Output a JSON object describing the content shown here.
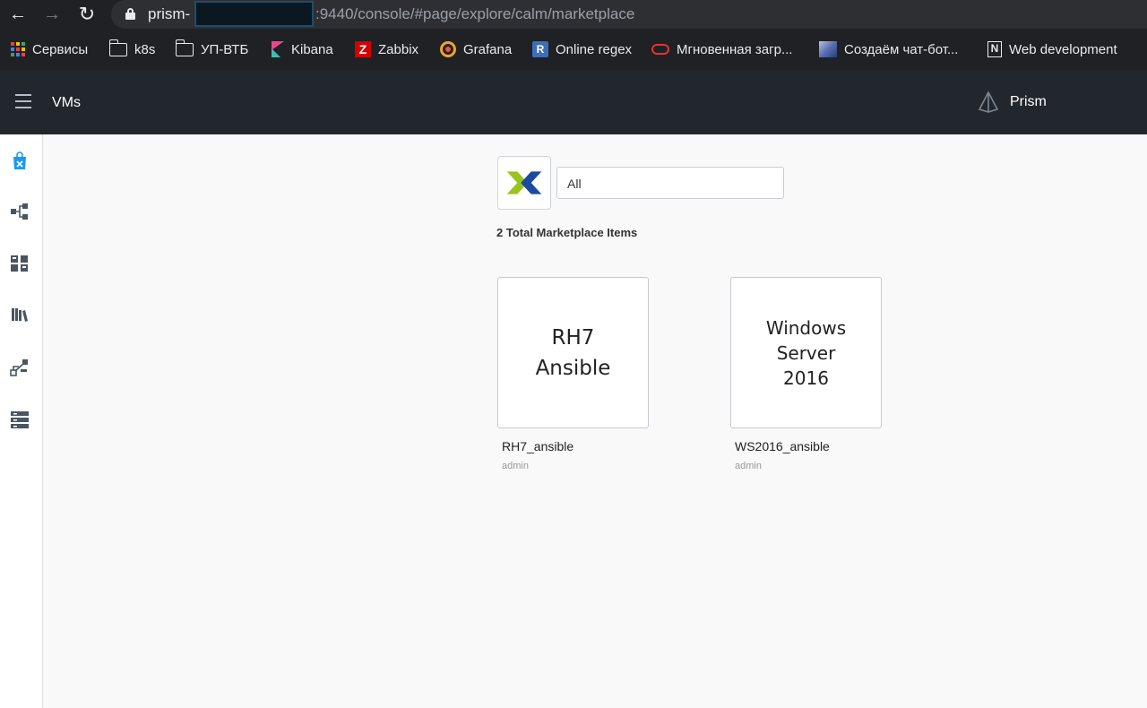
{
  "browser": {
    "url_host": "prism-",
    "url_path": ":9440/console/#page/explore/calm/marketplace",
    "bookmarks": [
      {
        "label": "Сервисы",
        "icon": "apps-grid-icon"
      },
      {
        "label": "k8s",
        "icon": "folder-icon"
      },
      {
        "label": "УП-ВТБ",
        "icon": "folder-icon"
      },
      {
        "label": "Kibana",
        "icon": "kibana-icon"
      },
      {
        "label": "Zabbix",
        "icon": "zabbix-icon"
      },
      {
        "label": "Grafana",
        "icon": "grafana-icon"
      },
      {
        "label": "Online regex",
        "icon": "regex-icon"
      },
      {
        "label": "Мгновенная загр...",
        "icon": "oracle-icon"
      },
      {
        "label": "Создаём чат-бот...",
        "icon": "chatbot-icon"
      },
      {
        "label": "Web development",
        "icon": "notion-icon"
      }
    ],
    "zabbix_letter": "Z",
    "regex_letter": "R",
    "notion_letter": "N"
  },
  "header": {
    "title": "VMs",
    "brand": "Prism"
  },
  "sidebar": {
    "items": [
      {
        "icon": "marketplace-bag-icon",
        "active": true
      },
      {
        "icon": "blueprint-tree-icon",
        "active": false
      },
      {
        "icon": "applications-grid-icon",
        "active": false
      },
      {
        "icon": "library-books-icon",
        "active": false
      },
      {
        "icon": "runbook-flow-icon",
        "active": false
      },
      {
        "icon": "providers-server-icon",
        "active": false
      }
    ]
  },
  "main": {
    "filter_value": "All",
    "total_label": "2 Total Marketplace Items",
    "items": [
      {
        "thumbnail_text": "RH7\nAnsible",
        "name": "RH7_ansible",
        "owner": "admin"
      },
      {
        "thumbnail_text": "Windows\nServer\n2016",
        "name": "WS2016_ansible",
        "owner": "admin"
      }
    ]
  },
  "colors": {
    "active_icon": "#1a9bf0",
    "inactive_icon": "#4a5562",
    "header_bg": "#22272e",
    "browser_bg": "#202124"
  }
}
